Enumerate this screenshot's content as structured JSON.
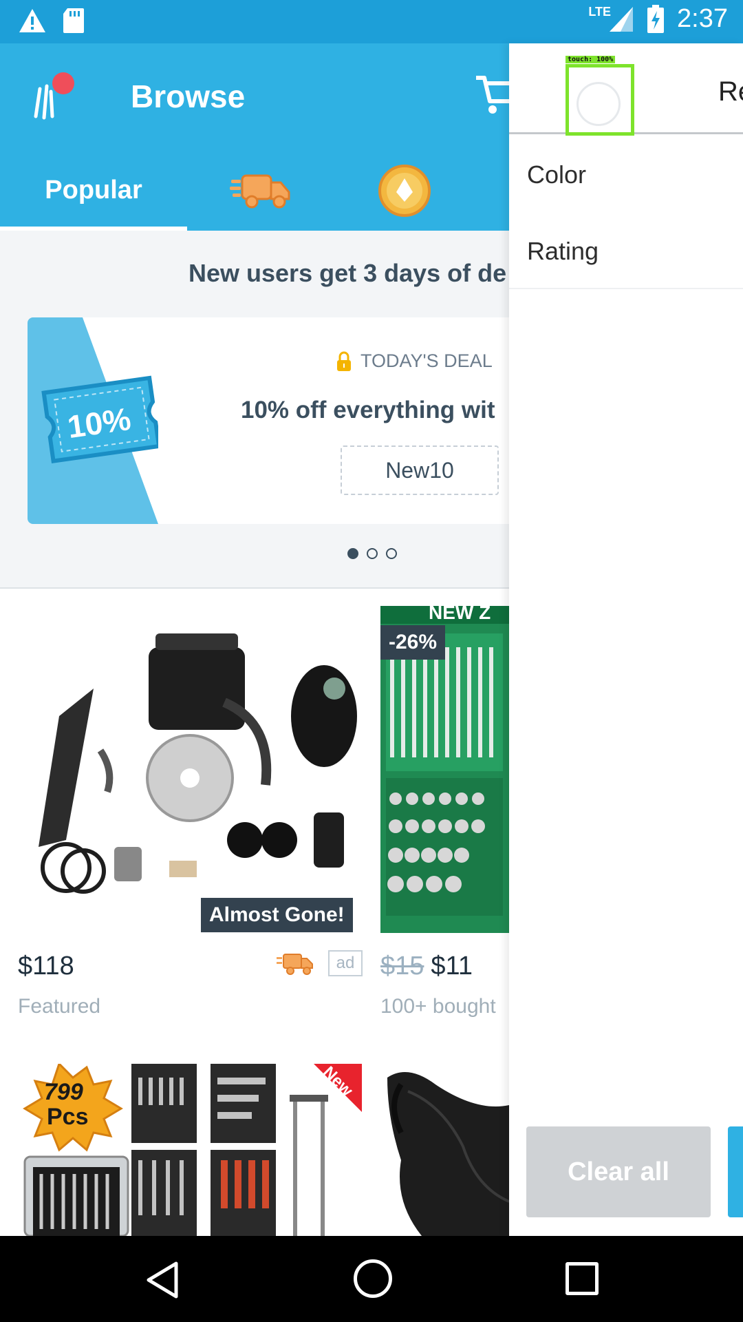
{
  "status_bar": {
    "time": "2:37",
    "network": "LTE",
    "icons": [
      "warning-icon",
      "sd-card-icon",
      "signal-icon",
      "battery-charging-icon"
    ]
  },
  "header": {
    "title": "Browse",
    "logo_icon": "wish-logo-icon",
    "cart_icon": "cart-icon"
  },
  "tabs": [
    {
      "label": "Popular",
      "active": true
    },
    {
      "label": "",
      "icon": "fast-shipping-truck-icon"
    },
    {
      "label": "",
      "icon": "coin-icon"
    }
  ],
  "promo": {
    "banner_text": "New users get 3 days of de",
    "deal_label": "TODAY'S DEAL",
    "deal_title": "10% off everything wit",
    "ticket_text": "10%",
    "coupon_code": "New10",
    "page_count": 3,
    "active_page": 0
  },
  "products": [
    {
      "price": "$118",
      "subtitle": "Featured",
      "badge": "Almost Gone!",
      "ad_label": "ad",
      "has_fast_shipping": true
    },
    {
      "old_price": "$15",
      "price": "$11",
      "subtitle": "100+ bought",
      "discount": "-26%",
      "image_text": "NEW Z"
    },
    {
      "image_text_top": "799",
      "image_text_bottom": "Pcs",
      "ribbon": "New"
    },
    {}
  ],
  "filter_panel": {
    "header_text": "Re",
    "items": [
      "Color",
      "Rating"
    ],
    "clear_button": "Clear all",
    "touch_overlay": "touch: 100%"
  },
  "colors": {
    "primary": "#2fb1e3",
    "status_bar": "#1d9fd8",
    "text_dark": "#3b4f5f",
    "badge": "#33424f",
    "touch_highlight": "#7ee32c"
  }
}
